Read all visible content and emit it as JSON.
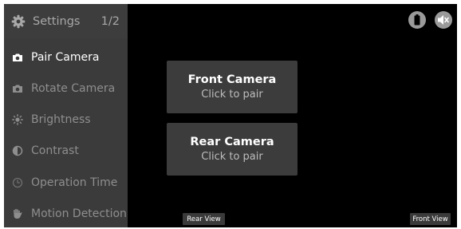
{
  "sidebar": {
    "title": "Settings",
    "page_indicator": "1/2",
    "items": [
      {
        "label": "Pair Camera",
        "icon": "camera-icon",
        "active": true
      },
      {
        "label": "Rotate Camera",
        "icon": "rotate-camera-icon",
        "active": false
      },
      {
        "label": "Brightness",
        "icon": "brightness-icon",
        "active": false
      },
      {
        "label": "Contrast",
        "icon": "contrast-icon",
        "active": false
      },
      {
        "label": "Operation Time",
        "icon": "clock-icon",
        "active": false
      },
      {
        "label": "Motion Detection",
        "icon": "hand-icon",
        "active": false
      }
    ]
  },
  "pair": {
    "front": {
      "title": "Front Camera",
      "subtitle": "Click to pair"
    },
    "rear": {
      "title": "Rear Camera",
      "subtitle": "Click to pair"
    }
  },
  "views": {
    "rear": "Rear View",
    "front": "Front View"
  },
  "status_icons": [
    "battery-icon",
    "mute-icon"
  ],
  "colors": {
    "background": "#000000",
    "sidebar": "#3b3b3b",
    "card": "#3c3c3c",
    "active_text": "#ffffff",
    "inactive_text": "#8e8e8e"
  }
}
